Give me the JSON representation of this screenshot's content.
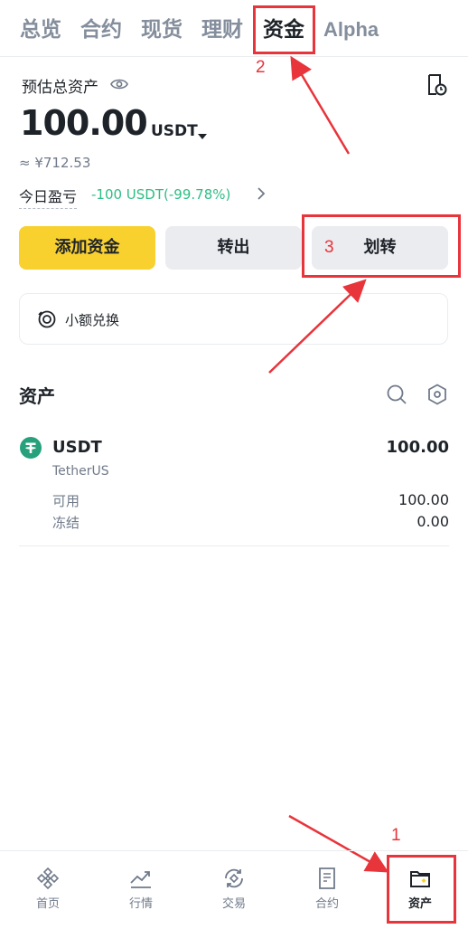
{
  "top_tabs": [
    "总览",
    "合约",
    "现货",
    "理财",
    "资金",
    "Alpha"
  ],
  "annotations": {
    "step1": "1",
    "step2": "2",
    "step3": "3"
  },
  "balance": {
    "label": "预估总资产",
    "amount": "100.00",
    "currency": "USDT",
    "fiat": "≈ ¥712.53",
    "pnl_label": "今日盈亏",
    "pnl_value": "-100 USDT(-99.78%)"
  },
  "actions": {
    "add_funds": "添加资金",
    "withdraw": "转出",
    "transfer": "划转"
  },
  "small_exchange": "小额兑换",
  "assets_section": {
    "title": "资产",
    "items": [
      {
        "symbol": "USDT",
        "name": "TetherUS",
        "total": "100.00",
        "available_label": "可用",
        "available": "100.00",
        "frozen_label": "冻结",
        "frozen": "0.00"
      }
    ]
  },
  "bottom_nav": [
    "首页",
    "行情",
    "交易",
    "合约",
    "资产"
  ],
  "colors": {
    "brand_yellow": "#f8d12f",
    "pnl_green": "#2ebd85",
    "annotation_red": "#e8343b",
    "usdt_teal": "#26a17b"
  }
}
